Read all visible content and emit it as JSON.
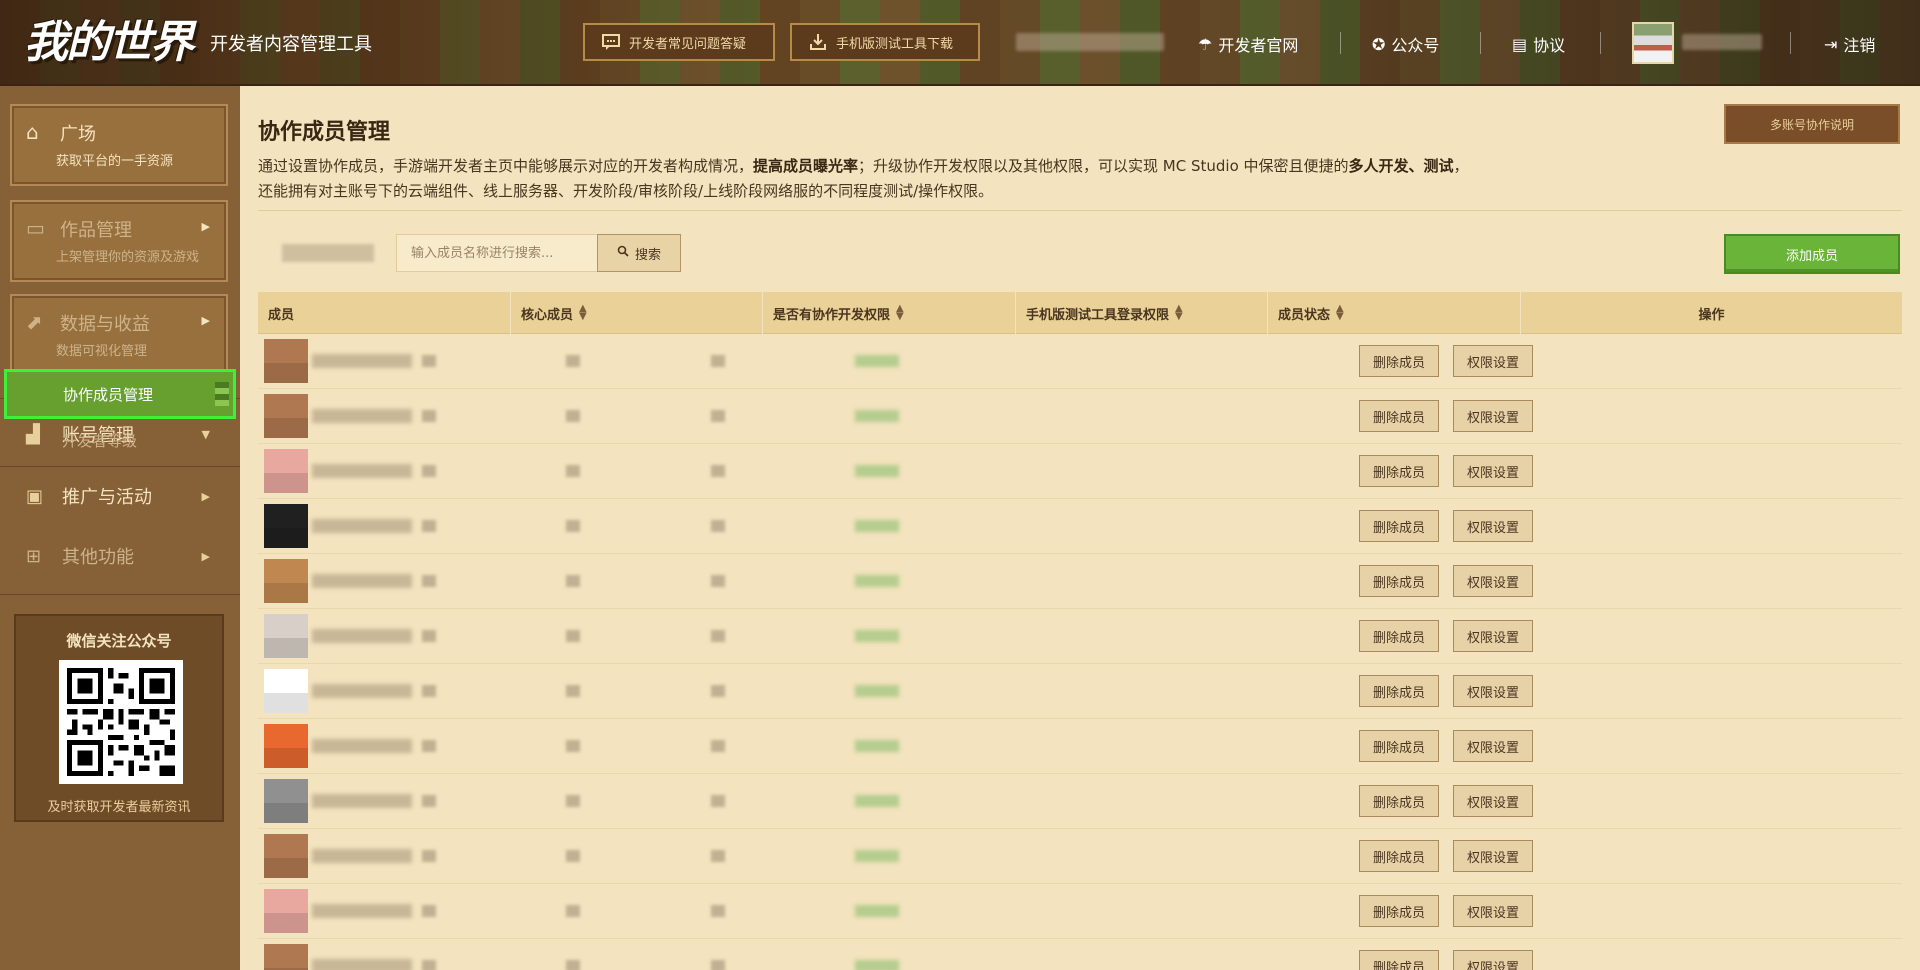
{
  "header": {
    "logo_text": "我的世界",
    "app_title": "开发者内容管理工具",
    "faq_button": "开发者常见问题答疑",
    "download_button": "手机版测试工具下载",
    "nav": [
      {
        "label": "开发者官网",
        "icon": "umbrella-icon"
      },
      {
        "label": "公众号",
        "icon": "badge-icon"
      },
      {
        "label": "协议",
        "icon": "document-icon"
      }
    ],
    "logout_label": "注销"
  },
  "sidebar": {
    "cards": [
      {
        "title": "广场",
        "sub": "获取平台的一手资源",
        "icon": "home-icon",
        "dim": false
      },
      {
        "title": "作品管理",
        "sub": "上架管理你的资源及游戏",
        "icon": "folder-icon",
        "dim": true
      },
      {
        "title": "数据与收益",
        "sub": "数据可视化管理",
        "icon": "chart-icon",
        "dim": true
      }
    ],
    "account_label": "账号管理",
    "sub_items": [
      "协作成员管理",
      "开发者等级"
    ],
    "promo_label": "推广与活动",
    "other_label": "其他功能",
    "wechat_title": "微信关注公众号",
    "wechat_sub": "及时获取开发者最新资讯"
  },
  "main": {
    "title": "协作成员管理",
    "help_button": "多账号协作说明",
    "desc_part1": "通过设置协作成员，手游端开发者主页中能够展示对应的开发者构成情况，",
    "desc_bold1": "提高成员曝光率",
    "desc_part2": "；升级协作开发权限以及其他权限，可以实现 MC Studio 中保密且便捷的",
    "desc_bold2": "多人开发、测试",
    "desc_part3": "，",
    "desc_line2": "还能拥有对主账号下的云端组件、线上服务器、开发阶段/审核阶段/上线阶段网络服的不同程度测试/操作权限。",
    "search_placeholder": "输入成员名称进行搜索...",
    "search_button": "搜索",
    "add_button": "添加成员",
    "table": {
      "headers": [
        "成员",
        "核心成员",
        "是否有协作开发权限",
        "手机版测试工具登录权限",
        "成员状态",
        "操作"
      ],
      "delete_label": "删除成员",
      "perm_label": "权限设置",
      "avatar_colors": [
        "#b07850",
        "#b07850",
        "#e8a8a0",
        "#202020",
        "#c08850",
        "#d8d0c8",
        "#ffffff",
        "#e86830",
        "#909090",
        "#b07850",
        "#e8a8a0",
        "#b07850"
      ]
    }
  }
}
